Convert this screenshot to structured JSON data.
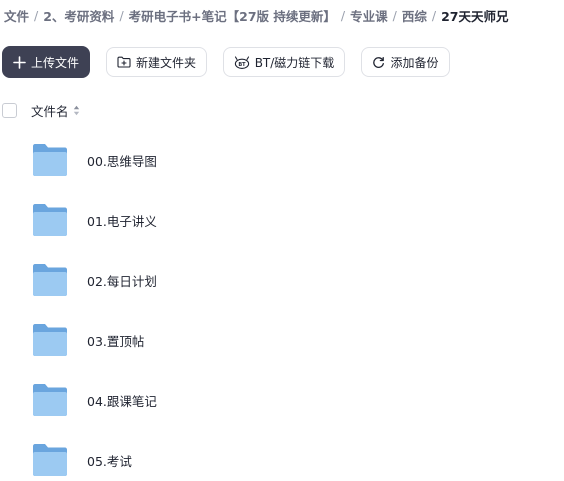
{
  "breadcrumb": [
    {
      "label": "文件"
    },
    {
      "label": "2、考研资料"
    },
    {
      "label": "考研电子书+笔记【27版 持续更新】"
    },
    {
      "label": "专业课"
    },
    {
      "label": "西综"
    },
    {
      "label": "27天天师兄"
    }
  ],
  "toolbar": {
    "upload_label": "上传文件",
    "new_folder_label": "新建文件夹",
    "bt_label": "BT/磁力链下载",
    "backup_label": "添加备份"
  },
  "list_header": {
    "name_label": "文件名"
  },
  "files": [
    {
      "name": "00.思维导图",
      "type": "folder"
    },
    {
      "name": "01.电子讲义",
      "type": "folder"
    },
    {
      "name": "02.每日计划",
      "type": "folder"
    },
    {
      "name": "03.置顶帖",
      "type": "folder"
    },
    {
      "name": "04.跟课笔记",
      "type": "folder"
    },
    {
      "name": "05.考试",
      "type": "folder"
    }
  ],
  "colors": {
    "primary_button": "#3e4154",
    "folder_back": "#6aa5de",
    "folder_front": "#9ccaf2"
  },
  "icons": {
    "upload": "plus-icon",
    "new_folder": "folder-plus-icon",
    "bt": "bt-magnet-icon",
    "backup": "refresh-icon",
    "sort": "sort-icon",
    "folder": "folder-icon"
  }
}
